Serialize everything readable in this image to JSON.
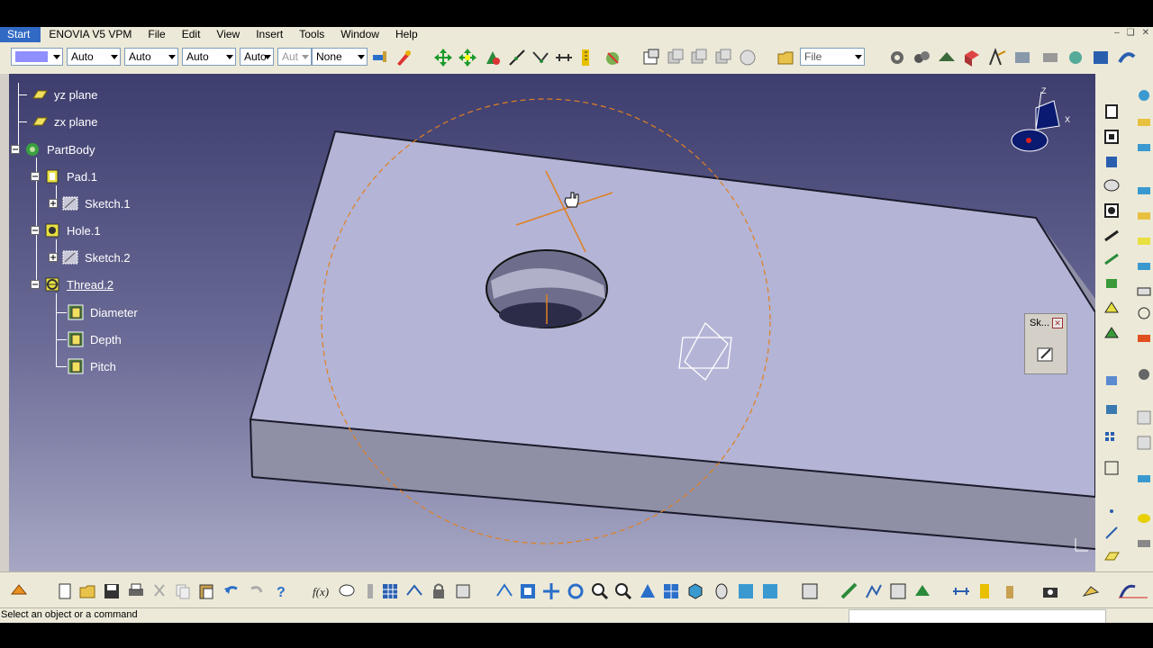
{
  "menu": {
    "start": "Start",
    "items": [
      "ENOVIA V5 VPM",
      "File",
      "Edit",
      "View",
      "Insert",
      "Tools",
      "Window",
      "Help"
    ]
  },
  "toolbar": {
    "linetype": "Auto",
    "thickness": "Auto",
    "linestyle": "Auto",
    "layer": "Auto",
    "transparency": "Aut",
    "render": "None",
    "file_selector": "File"
  },
  "tree": {
    "items": [
      {
        "label": "yz plane",
        "icon": "plane-icon"
      },
      {
        "label": "zx plane",
        "icon": "plane-icon"
      },
      {
        "label": "PartBody",
        "icon": "partbody-icon"
      },
      {
        "label": "Pad.1",
        "icon": "pad-icon"
      },
      {
        "label": "Sketch.1",
        "icon": "sketch-icon"
      },
      {
        "label": "Hole.1",
        "icon": "hole-icon"
      },
      {
        "label": "Sketch.2",
        "icon": "sketch-icon"
      },
      {
        "label": "Thread.2",
        "icon": "thread-icon"
      },
      {
        "label": "Diameter",
        "icon": "parameter-icon"
      },
      {
        "label": "Depth",
        "icon": "parameter-icon"
      },
      {
        "label": "Pitch",
        "icon": "parameter-icon"
      }
    ]
  },
  "sketch_panel": {
    "title": "Sk..."
  },
  "compass_axes": {
    "z": "Z",
    "x": "X"
  },
  "status": {
    "text": "Select an object or a command"
  },
  "colors": {
    "background_top": "#3d3d6e",
    "background_bottom": "#a7a7c4",
    "part_face": "#b4b4d6",
    "highlight": "#e08020"
  }
}
